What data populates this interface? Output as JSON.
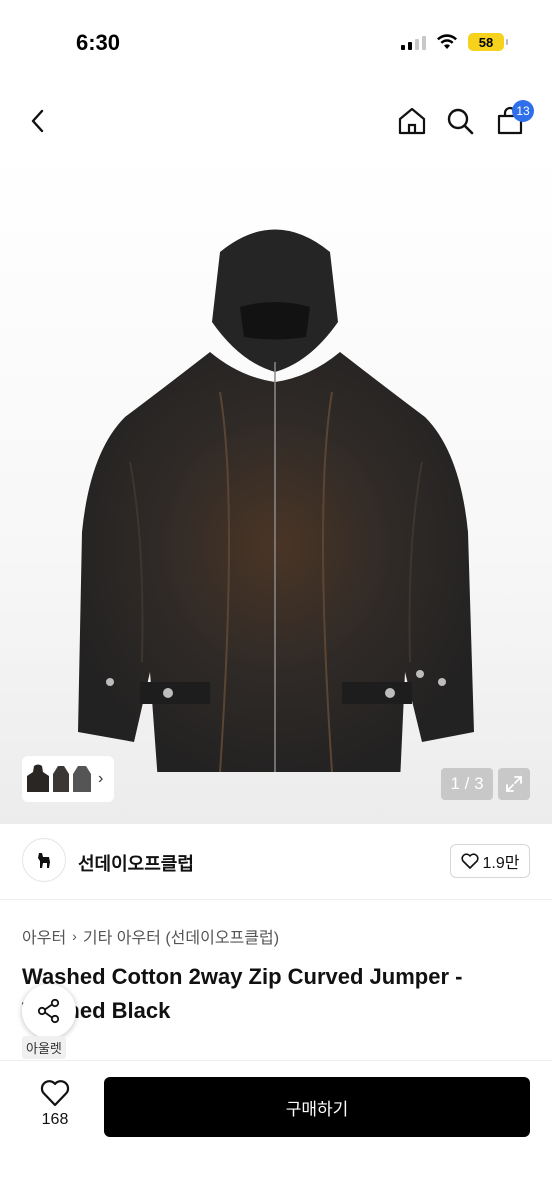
{
  "status_bar": {
    "time": "6:30",
    "battery": "58"
  },
  "nav": {
    "cart_badge": "13"
  },
  "gallery": {
    "page_indicator": "1 / 3",
    "thumbnail_count": 3
  },
  "brand": {
    "name": "선데이오프클럽",
    "like_count": "1.9만"
  },
  "breadcrumb": {
    "level1": "아우터",
    "level2": "기타 아우터 (선데이오프클럽)"
  },
  "product": {
    "title": "Washed Cotton 2way Zip Curved Jumper - Washed Black",
    "outlet_tag": "아울렛"
  },
  "bottom_bar": {
    "wish_count": "168",
    "buy_label": "구매하기"
  },
  "colors": {
    "accent": "#2f6fec",
    "battery": "#f6d21c",
    "buy_button": "#000000"
  },
  "icons": [
    "back-icon",
    "home-icon",
    "search-icon",
    "cart-icon",
    "expand-icon",
    "heart-icon",
    "share-icon",
    "chevron-right-icon"
  ]
}
